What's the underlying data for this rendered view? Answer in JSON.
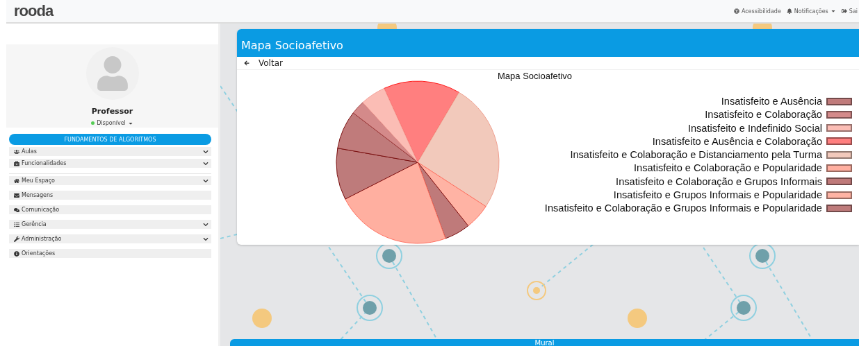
{
  "topbar": {
    "logo": "rooda",
    "links": [
      {
        "kind": "accessibility",
        "label": "Acessibilidade"
      },
      {
        "kind": "notifications",
        "label": "Notificações",
        "dropdown": true
      },
      {
        "kind": "exit",
        "label": "Sai",
        "dropdown": false
      }
    ]
  },
  "profile": {
    "name": "Professor",
    "status": "Disponível",
    "online": true
  },
  "sidebar": {
    "course": "FUNDAMENTOS DE ALGORITMOS",
    "groups": [
      [
        {
          "label": "Aulas",
          "expandable": true
        },
        {
          "label": "Funcionalidades",
          "expandable": true
        }
      ],
      [
        {
          "label": "Meu Espaço",
          "expandable": true
        },
        {
          "label": "Mensagens",
          "expandable": false
        },
        {
          "label": "Comunicação",
          "expandable": false
        },
        {
          "label": "Gerência",
          "expandable": true
        },
        {
          "label": "Administração",
          "expandable": true
        },
        {
          "label": "Orientações",
          "expandable": false
        }
      ]
    ]
  },
  "card": {
    "title": "Mapa Socioafetivo",
    "back": "Voltar",
    "chart_title": "Mapa Socioafetivo",
    "legend": [
      {
        "label": "Insatisfeito e Ausência",
        "color": "#c07b7b"
      },
      {
        "label": "Insatisfeito e Colaboração",
        "color": "#d48a8a"
      },
      {
        "label": "Insatisfeito e Indefinido Social",
        "color": "#fbbdb5"
      },
      {
        "label": "Insatisfeito e Ausência e Colaboração",
        "color": "#ff7f7f"
      },
      {
        "label": "Insatisfeito e Colaboração e Distanciamento pela Turma",
        "color": "#f2c9bb"
      },
      {
        "label": "Insatisfeito e Colaboração e Popularidade",
        "color": "#ffafa0"
      },
      {
        "label": "Insatisfeito e Colaboração e Grupos Informais",
        "color": "#bf7a7a"
      },
      {
        "label": "Insatisfeito e Grupos Informais e Popularidade",
        "color": "#ffb3a4"
      },
      {
        "label": "Insatisfeito e Colaboração e Grupos Informais e Popularidade",
        "color": "#be7b7b"
      }
    ]
  },
  "mural": {
    "title": "Mural"
  }
}
